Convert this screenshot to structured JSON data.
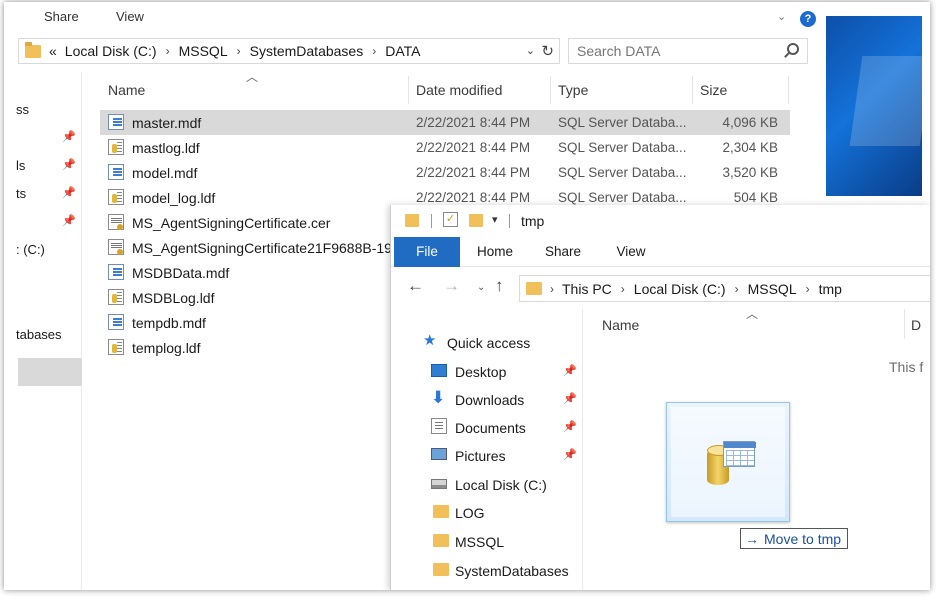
{
  "back_window": {
    "ribbon": {
      "share": "Share",
      "view": "View"
    },
    "address": {
      "prefix": "«",
      "crumbs": [
        "Local Disk (C:)",
        "MSSQL",
        "SystemDatabases",
        "DATA"
      ]
    },
    "search": {
      "placeholder": "Search DATA"
    },
    "nav_left": [
      "ss",
      "ls",
      "ts",
      ": (C:)",
      "tabases"
    ],
    "columns": {
      "name": "Name",
      "date": "Date modified",
      "type": "Type",
      "size": "Size"
    },
    "files": [
      {
        "name": "master.mdf",
        "date": "2/22/2021 8:44 PM",
        "type": "SQL Server Databa...",
        "size": "4,096 KB",
        "icon": "mdf-icon",
        "selected": true
      },
      {
        "name": "mastlog.ldf",
        "date": "2/22/2021 8:44 PM",
        "type": "SQL Server Databa...",
        "size": "2,304 KB",
        "icon": "ldf-icon"
      },
      {
        "name": "model.mdf",
        "date": "2/22/2021 8:44 PM",
        "type": "SQL Server Databa...",
        "size": "3,520 KB",
        "icon": "mdf-icon"
      },
      {
        "name": "model_log.ldf",
        "date": "2/22/2021 8:44 PM",
        "type": "SQL Server Databa...",
        "size": "504 KB",
        "icon": "ldf-icon"
      },
      {
        "name": "MS_AgentSigningCertificate.cer",
        "date": "",
        "type": "",
        "size": "",
        "icon": "cer-icon"
      },
      {
        "name": "MS_AgentSigningCertificate21F9688B-19...",
        "date": "",
        "type": "",
        "size": "",
        "icon": "cer-icon"
      },
      {
        "name": "MSDBData.mdf",
        "date": "",
        "type": "",
        "size": "",
        "icon": "mdf-icon"
      },
      {
        "name": "MSDBLog.ldf",
        "date": "",
        "type": "",
        "size": "",
        "icon": "ldf-icon"
      },
      {
        "name": "tempdb.mdf",
        "date": "",
        "type": "",
        "size": "",
        "icon": "mdf-icon"
      },
      {
        "name": "templog.ldf",
        "date": "",
        "type": "",
        "size": "",
        "icon": "ldf-icon"
      }
    ]
  },
  "front_window": {
    "title": "tmp",
    "ribbon_tabs": [
      "File",
      "Home",
      "Share",
      "View"
    ],
    "address": {
      "crumbs": [
        "This PC",
        "Local Disk (C:)",
        "MSSQL",
        "tmp"
      ]
    },
    "nav_tree": [
      {
        "label": "Quick access",
        "icon": "star-icon",
        "pinned": false
      },
      {
        "label": "Desktop",
        "icon": "desktop-icon",
        "pinned": true
      },
      {
        "label": "Downloads",
        "icon": "download-icon",
        "pinned": true
      },
      {
        "label": "Documents",
        "icon": "documents-icon",
        "pinned": true
      },
      {
        "label": "Pictures",
        "icon": "pictures-icon",
        "pinned": true
      },
      {
        "label": "Local Disk (C:)",
        "icon": "drive-icon",
        "pinned": false
      },
      {
        "label": "LOG",
        "icon": "folder-icon",
        "pinned": false
      },
      {
        "label": "MSSQL",
        "icon": "folder-icon",
        "pinned": false
      },
      {
        "label": "SystemDatabases",
        "icon": "folder-icon",
        "pinned": false
      }
    ],
    "content": {
      "column_name": "Name",
      "column_d": "D",
      "empty_text": "This f"
    }
  },
  "drag_ghost": {
    "icon": "database-file-icon",
    "tooltip": "Move to tmp"
  },
  "colors": {
    "file_tab": "#1f6cc2",
    "selection": "#d9d9d9",
    "tooltip_text": "#1a4f9c",
    "folder": "#f1c05a"
  }
}
